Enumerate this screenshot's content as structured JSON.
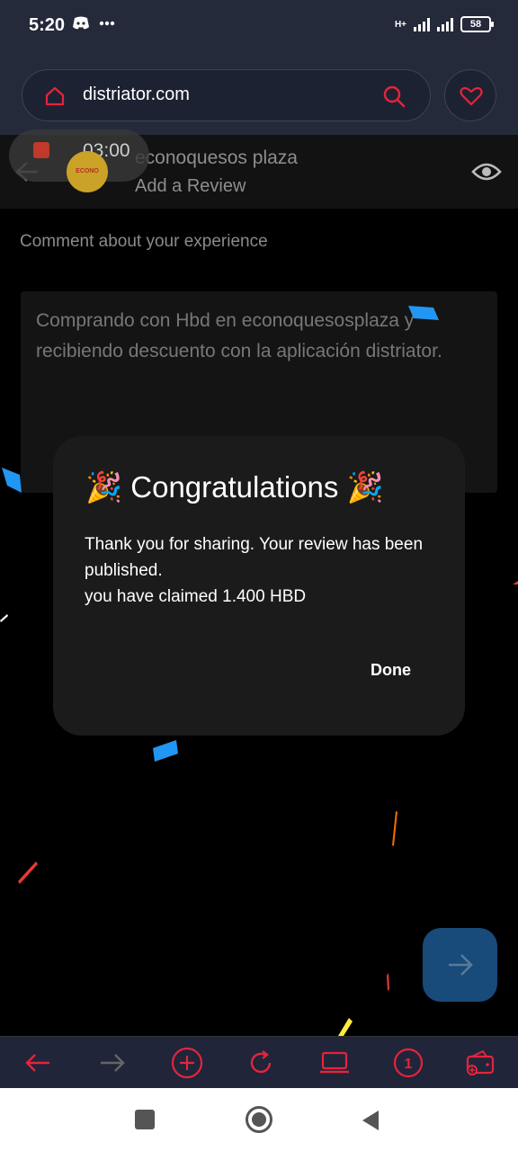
{
  "status_bar": {
    "time": "5:20",
    "network": "H+",
    "battery": "58"
  },
  "browser": {
    "url": "distriator.com"
  },
  "recorder": {
    "timer": "03:00"
  },
  "header": {
    "store_name": "econoquesos plaza",
    "subtitle": "Add a Review",
    "logo_text": "ECONO QUESOS"
  },
  "form": {
    "prompt": "Comment about your experience",
    "review_text": "Comprando con Hbd en econoquesosplaza y recibiendo descuento con la aplicación distriator."
  },
  "dialog": {
    "title": "🎉 Congratulations 🎉",
    "message_line1": "Thank you for sharing. Your review has been published.",
    "message_line2": "you have claimed 1.400 HBD",
    "done_label": "Done"
  },
  "bottom_bar": {
    "tabs_count": "1"
  },
  "colors": {
    "accent": "#e5243b",
    "topbar": "#252a3a",
    "fab": "#184a7a"
  }
}
